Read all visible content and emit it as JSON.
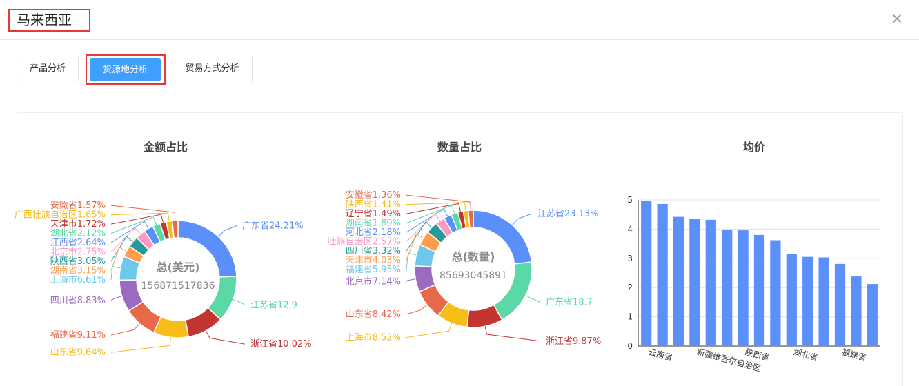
{
  "dialog": {
    "title": "马来西亚",
    "close_icon": "×"
  },
  "tabs": [
    {
      "label": "产品分析",
      "active": false
    },
    {
      "label": "货源地分析",
      "active": true
    },
    {
      "label": "贸易方式分析",
      "active": false
    }
  ],
  "colors": [
    "#5b8ff9",
    "#5ad8a6",
    "#c23531",
    "#f6bd16",
    "#e8684a",
    "#9b6bc2",
    "#6dc8ec",
    "#ff9d4d",
    "#269a99",
    "#ff99c3",
    "#5b8ff9",
    "#5ad8a6",
    "#c23531",
    "#f6bd16",
    "#e8684a"
  ],
  "chart_data": [
    {
      "type": "pie",
      "title": "金额占比",
      "center_name": "总(美元)",
      "center_value": "156871517836",
      "slices": [
        {
          "label": "广东省24.21%",
          "value": 24.21
        },
        {
          "label": "江苏省12.9",
          "value": 12.9
        },
        {
          "label": "浙江省10.02%",
          "value": 10.02
        },
        {
          "label": "山东省9.64%",
          "value": 9.64
        },
        {
          "label": "福建省9.11%",
          "value": 9.11
        },
        {
          "label": "四川省8.83%",
          "value": 8.83
        },
        {
          "label": "上海市6.61%",
          "value": 6.61
        },
        {
          "label": "湖南省3.15%",
          "value": 3.15
        },
        {
          "label": "陕西省3.05%",
          "value": 3.05
        },
        {
          "label": "北京市2.75%",
          "value": 2.75
        },
        {
          "label": "江西省2.64%",
          "value": 2.64
        },
        {
          "label": "湖北省2.12%",
          "value": 2.12
        },
        {
          "label": "天津市1.72%",
          "value": 1.72
        },
        {
          "label": "广西壮族自治区1.65%",
          "value": 1.65
        },
        {
          "label": "安徽省1.57%",
          "value": 1.57
        }
      ]
    },
    {
      "type": "pie",
      "title": "数量占比",
      "center_name": "总(数量)",
      "center_value": "85693045891",
      "slices": [
        {
          "label": "江苏省23.13%",
          "value": 23.13
        },
        {
          "label": "广东省18.7",
          "value": 18.7
        },
        {
          "label": "浙江省9.87%",
          "value": 9.87
        },
        {
          "label": "上海市8.52%",
          "value": 8.52
        },
        {
          "label": "山东省8.42%",
          "value": 8.42
        },
        {
          "label": "北京市7.14%",
          "value": 7.14
        },
        {
          "label": "福建省5.95%",
          "value": 5.95
        },
        {
          "label": "天津市4.03%",
          "value": 4.03
        },
        {
          "label": "四川省3.32%",
          "value": 3.32
        },
        {
          "label": "吐族自治区2.57%",
          "value": 2.57
        },
        {
          "label": "河北省2.18%",
          "value": 2.18
        },
        {
          "label": "湖南省1.89%",
          "value": 1.89
        },
        {
          "label": "辽宁省1.49%",
          "value": 1.49
        },
        {
          "label": "陕西省1.41%",
          "value": 1.41
        },
        {
          "label": "安徽省1.36%",
          "value": 1.36
        }
      ]
    },
    {
      "type": "bar",
      "title": "均价",
      "ylim": [
        0,
        5
      ],
      "yticks": [
        "0",
        "1",
        "2",
        "3",
        "4",
        "5"
      ],
      "values": [
        4.96,
        4.86,
        4.42,
        4.36,
        4.32,
        3.98,
        3.96,
        3.8,
        3.62,
        3.14,
        3.05,
        3.03,
        2.81,
        2.38,
        2.12
      ],
      "visible_category_labels": [
        "云南省",
        "新疆维吾尔自治区",
        "陕西省",
        "湖北省",
        "福建省"
      ],
      "bar_color": "#5b8ff9"
    }
  ]
}
